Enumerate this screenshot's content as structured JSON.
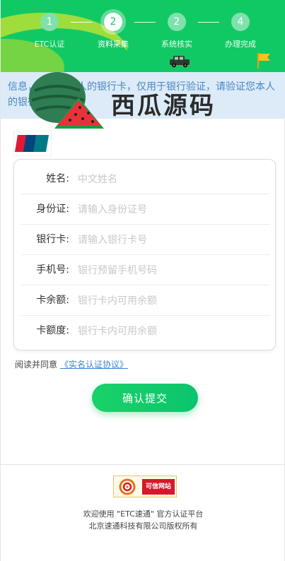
{
  "steps": [
    {
      "num": "1",
      "label": "ETC认证",
      "active": false
    },
    {
      "num": "2",
      "label": "资料采集",
      "active": true
    },
    {
      "num": "2",
      "label": "系统核实",
      "active": false
    },
    {
      "num": "4",
      "label": "办理完成",
      "active": false
    }
  ],
  "notice": {
    "text": "信息，请使用本人的银行卡，仅用于银行验证，请验证您本人的银行卡。"
  },
  "watermark": {
    "text": "西瓜源码"
  },
  "unionpay": {
    "label": "UnionPay 银联"
  },
  "form": {
    "fields": [
      {
        "label": "姓名:",
        "placeholder": "中文姓名",
        "value": ""
      },
      {
        "label": "身份证:",
        "placeholder": "请输入身份证号",
        "value": ""
      },
      {
        "label": "银行卡:",
        "placeholder": "请输入银行卡号",
        "value": ""
      },
      {
        "label": "手机号:",
        "placeholder": "银行预留手机号码",
        "value": ""
      },
      {
        "label": "卡余额:",
        "placeholder": "银行卡内可用余额",
        "value": ""
      },
      {
        "label": "卡额度:",
        "placeholder": "银行卡内可用余额",
        "value": ""
      }
    ]
  },
  "agreement": {
    "prefix": "阅读并同意",
    "link": "《实名认证协议》"
  },
  "submit": {
    "label": "确认提交"
  },
  "footer": {
    "badge": "可信网站",
    "line1": "欢迎使用 \"ETC速通\" 官方认证平台",
    "line2": "北京速通科技有限公司版权所有"
  },
  "colors": {
    "brand": "#11c964",
    "notice_bg": "#dcebf7",
    "notice_text": "#4a86c5",
    "link": "#3f86d4"
  }
}
